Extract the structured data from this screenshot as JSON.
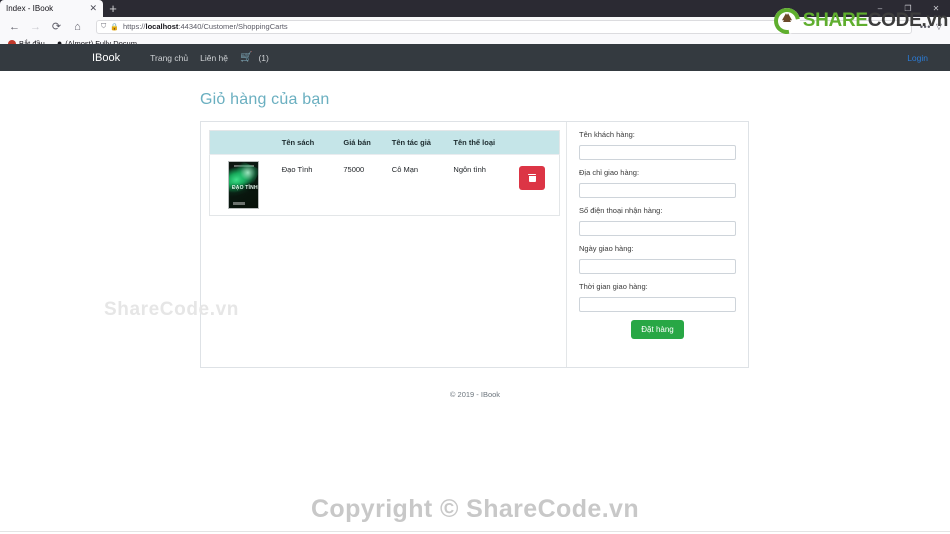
{
  "browser": {
    "tab_title": "Index - IBook",
    "tab_close": "✕",
    "new_tab": "+",
    "back": "←",
    "forward": "→",
    "reload": "⟳",
    "home": "⌂",
    "shield_icon": "⛉",
    "lock_icon": "🔒",
    "url_scheme": "https://",
    "url_host": "localhost",
    "url_rest": ":44340/Customer/ShoppingCarts",
    "more_options": "•••",
    "pocket_icon": "▽",
    "window_minimize": "–",
    "window_maximize": "❐",
    "window_close": "✕",
    "bookmarks": [
      {
        "label": "Bắt đầu",
        "icon": "firefox-icon"
      },
      {
        "label": "(Almost) Fully Docum...",
        "icon": "github-icon"
      }
    ]
  },
  "watermark_logo": {
    "text_green": "SHARE",
    "text_dark": "CODE.vn"
  },
  "site_nav": {
    "brand": "IBook",
    "links": [
      {
        "label": "Trang chủ",
        "name": "nav-link-home"
      },
      {
        "label": "Liên hệ",
        "name": "nav-link-contact"
      }
    ],
    "cart_icon": "🛒",
    "cart_count": "(1)",
    "login": "Login"
  },
  "page": {
    "title": "Giỏ hàng của bạn"
  },
  "cart_table": {
    "headers": [
      {
        "label": "",
        "key": "image"
      },
      {
        "label": "Tên sách",
        "key": "name"
      },
      {
        "label": "Giá bán",
        "key": "price"
      },
      {
        "label": "Tên tác giả",
        "key": "author"
      },
      {
        "label": "Tên thể loại",
        "key": "category"
      },
      {
        "label": "",
        "key": "action"
      }
    ],
    "rows": [
      {
        "cover_title": "ĐẠO TÌNH",
        "name": "Đạo Tình",
        "price": "75000",
        "author": "Cô Mạn",
        "category": "Ngôn tình",
        "delete_icon": "trash-icon"
      }
    ]
  },
  "order_form": {
    "fields": [
      {
        "label": "Tên khách hàng:",
        "value": "",
        "name": "customer-name-input"
      },
      {
        "label": "Địa chỉ giao hàng:",
        "value": "",
        "name": "delivery-address-input"
      },
      {
        "label": "Số điện thoại nhận hàng:",
        "value": "",
        "name": "phone-number-input"
      },
      {
        "label": "Ngày giao hàng:",
        "value": "",
        "name": "delivery-date-input"
      },
      {
        "label": "Thời gian giao hàng:",
        "value": "",
        "name": "delivery-time-input"
      }
    ],
    "submit_label": "Đặt hàng"
  },
  "footer": {
    "text": "© 2019 - IBook"
  },
  "watermarks": {
    "middle": "ShareCode.vn",
    "bottom": "Copyright © ShareCode.vn"
  },
  "colors": {
    "navbar_bg": "#343a40",
    "title": "#6aafc0",
    "table_header_bg": "#c5e5e8",
    "delete_btn": "#dc3545",
    "order_btn": "#28a745",
    "login_link": "#2b7bd6",
    "brand_green": "#5fae2e"
  }
}
